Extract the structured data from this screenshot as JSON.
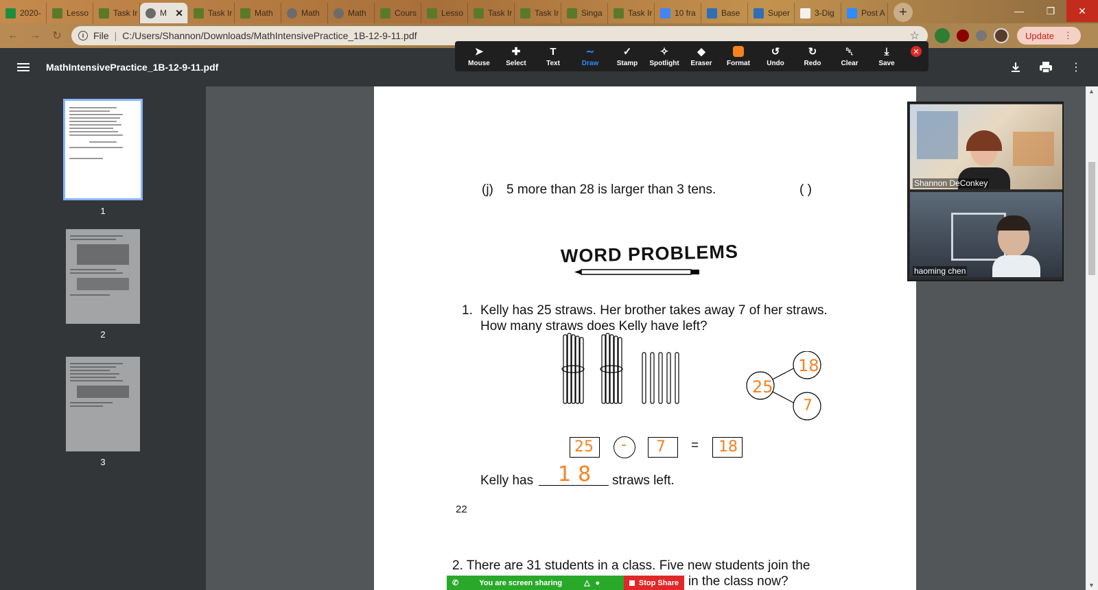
{
  "browser": {
    "tabs": [
      {
        "label": "2020-",
        "icon": "sheets-icon"
      },
      {
        "label": "Lesso",
        "icon": "doc-green-icon"
      },
      {
        "label": "Task Ir",
        "icon": "doc-green-icon"
      },
      {
        "label": "M",
        "icon": "globe-icon",
        "active": true
      },
      {
        "label": "Task Ir",
        "icon": "doc-green-icon"
      },
      {
        "label": "Math",
        "icon": "doc-green-icon"
      },
      {
        "label": "Math",
        "icon": "globe-icon"
      },
      {
        "label": "Math",
        "icon": "globe-icon"
      },
      {
        "label": "Cours",
        "icon": "doc-green-icon"
      },
      {
        "label": "Lesso",
        "icon": "doc-green-icon"
      },
      {
        "label": "Task Ir",
        "icon": "doc-green-icon"
      },
      {
        "label": "Task Ir",
        "icon": "doc-green-icon"
      },
      {
        "label": "Singa",
        "icon": "doc-green-icon"
      },
      {
        "label": "Task Ir",
        "icon": "doc-green-icon"
      },
      {
        "label": "10 fra",
        "icon": "docs-blue-icon"
      },
      {
        "label": "Base",
        "icon": "app-icon"
      },
      {
        "label": "Super",
        "icon": "app-icon"
      },
      {
        "label": "3-Dig",
        "icon": "co-icon"
      },
      {
        "label": "Post A",
        "icon": "zoom-icon"
      }
    ],
    "address": {
      "scheme_label": "File",
      "url": "C:/Users/Shannon/Downloads/MathIntensivePractice_1B-12-9-11.pdf"
    },
    "update_label": "Update"
  },
  "pdf": {
    "filename": "MathIntensivePractice_1B-12-9-11.pdf",
    "thumbnails": [
      {
        "number": "1",
        "selected": true
      },
      {
        "number": "2",
        "selected": false
      },
      {
        "number": "3",
        "selected": false
      }
    ]
  },
  "annotate": {
    "tools": [
      {
        "label": "Mouse",
        "icon": "mouse-pointer-icon"
      },
      {
        "label": "Select",
        "icon": "select-move-icon"
      },
      {
        "label": "Text",
        "icon": "text-icon"
      },
      {
        "label": "Draw",
        "icon": "draw-icon",
        "active": true
      },
      {
        "label": "Stamp",
        "icon": "stamp-icon"
      },
      {
        "label": "Spotlight",
        "icon": "spotlight-icon"
      },
      {
        "label": "Eraser",
        "icon": "eraser-icon"
      },
      {
        "label": "Format",
        "icon": "format-icon"
      },
      {
        "label": "Undo",
        "icon": "undo-icon"
      },
      {
        "label": "Redo",
        "icon": "redo-icon"
      },
      {
        "label": "Clear",
        "icon": "trash-icon"
      },
      {
        "label": "Save",
        "icon": "save-icon"
      }
    ],
    "active_color": "#f5821f"
  },
  "page": {
    "item_j_label": "(j)",
    "item_j_text": "5 more than 28 is larger than 3 tens.",
    "item_j_paren": "(        )",
    "section_title": "WORD PROBLEMS",
    "problem1_number": "1.",
    "problem1_line1": "Kelly has 25 straws.  Her brother takes away 7 of her straws.",
    "problem1_line2": "How many straws does Kelly have left?",
    "equals": "=",
    "answer_prefix": "Kelly has",
    "answer_suffix": "straws left.",
    "page_number": "22",
    "handwriting": {
      "bond_whole": "25",
      "bond_part1": "18",
      "bond_part2": "7",
      "eq_a": "25",
      "eq_op": "-",
      "eq_b": "7",
      "eq_result": "18",
      "answer": "18",
      "ink_color": "#f5821f"
    },
    "problem2_line1": "2.  There are 31 students in a class.  Five new students join the",
    "problem2_line2": "e in the class now?"
  },
  "video": {
    "participants": [
      {
        "name": "Shannon DeConkey"
      },
      {
        "name": "haoming chen"
      }
    ]
  },
  "share_banner": {
    "status": "You are screen sharing",
    "stop_label": "Stop Share"
  }
}
